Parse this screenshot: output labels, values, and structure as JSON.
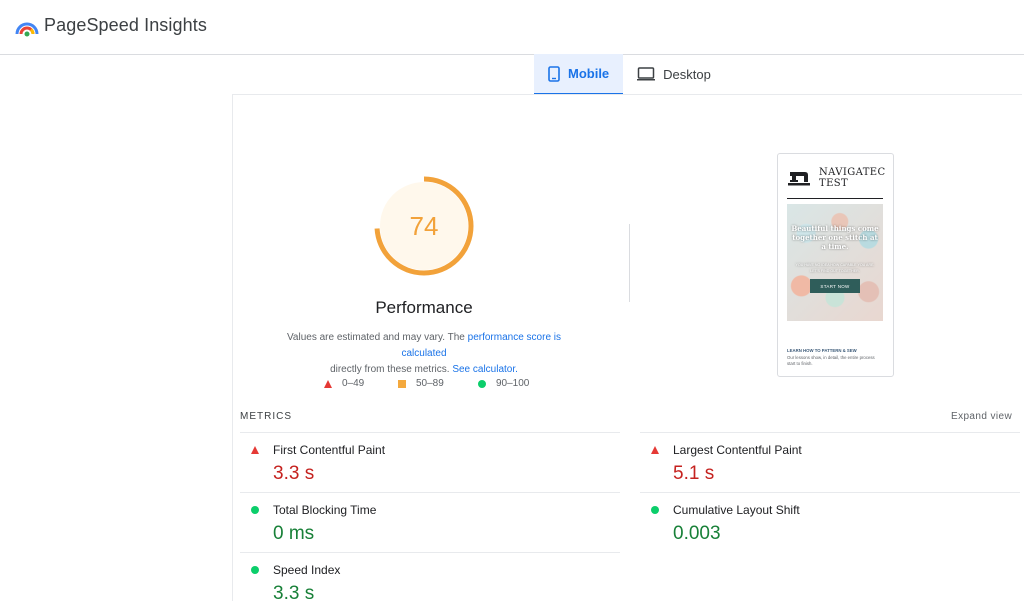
{
  "header": {
    "app_title": "PageSpeed Insights",
    "logo": "pagespeed-logo-icon"
  },
  "tabs": [
    {
      "label": "Mobile",
      "icon": "mobile-icon",
      "active": true
    },
    {
      "label": "Desktop",
      "icon": "desktop-icon",
      "active": false
    }
  ],
  "score": {
    "value": "74",
    "fraction": 0.74,
    "color": "#f2a23a",
    "label": "Performance"
  },
  "note": {
    "text1": "Values are estimated and may vary. The ",
    "link1": "performance score is calculated",
    "text2": " directly from these metrics. ",
    "link2": "See calculator."
  },
  "legend": [
    {
      "range": "0–49",
      "shape": "triangle",
      "color": "#e53935"
    },
    {
      "range": "50–89",
      "shape": "square",
      "color": "#f4a93e"
    },
    {
      "range": "90–100",
      "shape": "circle",
      "color": "#0cce6b"
    }
  ],
  "screenshot": {
    "brand_line1": "NAVIGATEC",
    "brand_line2": "TEST",
    "hero_heading": "Beautiful things come together one stitch at a time.",
    "hero_sub": "YOU HAVE NO IDEA HOW CAPABLE YOU ARE. LET'S FIND OUT TOGETHER.",
    "cta": "START NOW",
    "link": "LEARN HOW TO PATTERN & SEW",
    "body": "Our lessons show, in detail, the entire process start to finish."
  },
  "metrics": {
    "label": "METRICS",
    "expand": "Expand view",
    "items": [
      {
        "name": "First Contentful Paint",
        "value": "3.3 s",
        "status": "bad"
      },
      {
        "name": "Largest Contentful Paint",
        "value": "5.1 s",
        "status": "bad"
      },
      {
        "name": "Total Blocking Time",
        "value": "0 ms",
        "status": "good"
      },
      {
        "name": "Cumulative Layout Shift",
        "value": "0.003",
        "status": "good"
      },
      {
        "name": "Speed Index",
        "value": "3.3 s",
        "status": "good"
      }
    ]
  }
}
